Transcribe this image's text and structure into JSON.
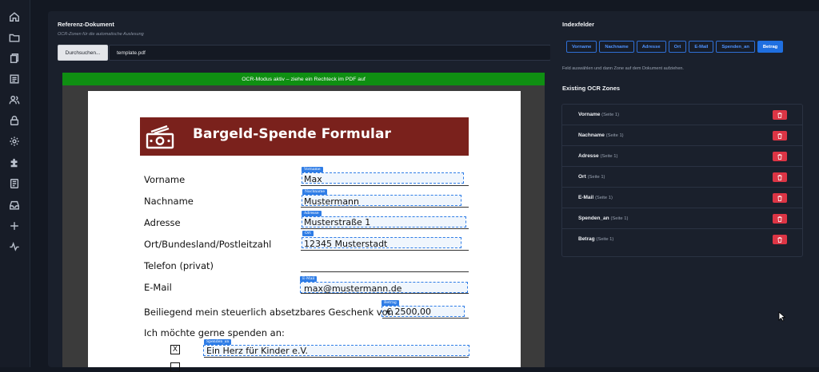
{
  "sidebar": {
    "icons": [
      "home-icon",
      "folder-icon",
      "documents-icon",
      "list-icon",
      "users-icon",
      "lock-icon",
      "settings-icon",
      "puzzle-icon",
      "form-icon",
      "inbox-icon",
      "plus-icon",
      "activity-icon"
    ]
  },
  "reference": {
    "title": "Referenz-Dokument",
    "subtitle": "OCR-Zonen für die automatische Auslesung",
    "browse_label": "Durchsuchen...",
    "file_name": "template.pdf"
  },
  "ocr_banner": "OCR-Modus aktiv – ziehe ein Rechteck im PDF auf",
  "pdf": {
    "header_title": "Bargeld-Spende Formular",
    "labels": {
      "vorname": "Vorname",
      "nachname": "Nachname",
      "adresse": "Adresse",
      "ort": "Ort/Bundesland/Postleitzahl",
      "telefon": "Telefon (privat)",
      "email": "E-Mail",
      "geschenk": "Beiliegend mein steuerlich absetzbares Geschenk von",
      "spenden": "Ich möchte gerne spenden an:"
    },
    "zones": {
      "vorname": {
        "tag": "Vorname",
        "value": "Max"
      },
      "nachname": {
        "tag": "Nachname",
        "value": "Mustermann"
      },
      "adresse": {
        "tag": "Adresse",
        "value": "Musterstraße 1"
      },
      "ort": {
        "tag": "Ort",
        "value": "12345 Musterstadt"
      },
      "email": {
        "tag": "E-Mail",
        "value": "max@mustermann.de"
      },
      "betrag": {
        "tag": "Betrag",
        "value": "€ 2500,00"
      },
      "spenden_an": {
        "tag": "Spenden_an",
        "value": "Ein Herz für Kinder e.V."
      }
    },
    "checkbox_mark": "X"
  },
  "index_fields": {
    "title": "Indexfelder",
    "chips": [
      "Vorname",
      "Nachname",
      "Adresse",
      "Ort",
      "E-Mail",
      "Spenden_an",
      "Betrag"
    ],
    "active": "Betrag",
    "hint": "Feld auswählen und dann Zone auf dem Dokument aufziehen."
  },
  "existing": {
    "title": "Existing OCR Zones",
    "rows": [
      {
        "name": "Vorname",
        "page": "(Seite 1)"
      },
      {
        "name": "Nachname",
        "page": "(Seite 1)"
      },
      {
        "name": "Adresse",
        "page": "(Seite 1)"
      },
      {
        "name": "Ort",
        "page": "(Seite 1)"
      },
      {
        "name": "E-Mail",
        "page": "(Seite 1)"
      },
      {
        "name": "Spenden_an",
        "page": "(Seite 1)"
      },
      {
        "name": "Betrag",
        "page": "(Seite 1)"
      }
    ]
  },
  "colors": {
    "accent": "#1f6fe0",
    "banner": "#0f8f12",
    "danger": "#dc3545",
    "pdf_header": "#7a211c"
  }
}
